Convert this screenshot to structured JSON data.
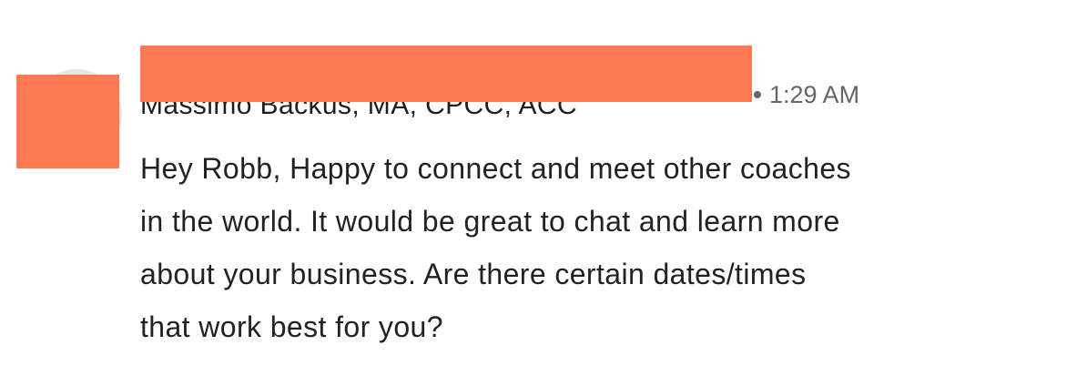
{
  "message": {
    "sender": {
      "name": "Massimo Backus, MA, CPCC, ACC"
    },
    "timestamp": "1:29 AM",
    "body_lines": [
      "Hey Robb, Happy to connect and meet other coaches",
      "in the world. It would be great to chat and learn more",
      "about your business. Are there certain dates/times",
      "that work best for you?"
    ]
  },
  "colors": {
    "redaction": "#fe7a52",
    "text_primary": "#222222",
    "text_secondary": "#666666",
    "background": "#ffffff"
  },
  "icons": {
    "avatar": "profile-photo",
    "separator": "bullet-dot"
  }
}
